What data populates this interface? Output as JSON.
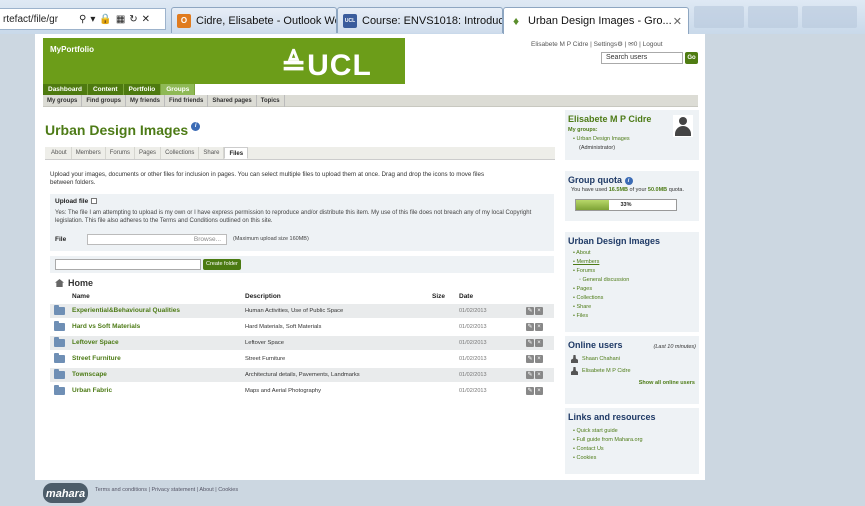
{
  "browser": {
    "address_url": "rtefact/file/gr",
    "tabs": [
      {
        "title": "Cidre, Elisabete - Outlook Web...",
        "icon": "outlook-icon"
      },
      {
        "title": "Course: ENVS1018: Introducing...",
        "icon": "ucl-course-icon"
      },
      {
        "title": "Urban Design Images - Gro...",
        "icon": "mahara-icon"
      }
    ]
  },
  "header": {
    "site_name": "MyPortfolio",
    "logo_text": "≜UCL",
    "user_name": "Elisabete M P Cidre",
    "settings_label": "Settings",
    "inbox_label": "0",
    "logout_label": "Logout",
    "search_placeholder": "Search users",
    "go_label": "Go"
  },
  "main_nav": [
    "Dashboard",
    "Content",
    "Portfolio",
    "Groups"
  ],
  "sub_nav": [
    "My groups",
    "Find groups",
    "My friends",
    "Find friends",
    "Shared pages",
    "Topics"
  ],
  "group": {
    "title": "Urban Design Images",
    "tabs": [
      "About",
      "Members",
      "Forums",
      "Pages",
      "Collections",
      "Share",
      "Files"
    ],
    "active_tab": "Files"
  },
  "files": {
    "intro": "Upload your images, documents or other files for inclusion in pages. You can select multiple files to upload them at once. Drag and drop the icons to move files between folders.",
    "upload_title": "Upload file",
    "declaration": "Yes: The file I am attempting to upload is my own or I have express permission to reproduce and/or distribute this item. My use of this file does not breach any of my local Copyright legislation. This file also adheres to the Terms and Conditions outlined on this site.",
    "file_label": "File",
    "browse_label": "Browse...",
    "max_size": "(Maximum upload size 160MB)",
    "create_folder_label": "Create folder",
    "home_label": "Home",
    "columns": {
      "name": "Name",
      "description": "Description",
      "size": "Size",
      "date": "Date"
    },
    "rows": [
      {
        "name": "Experiential&Behavioural Qualities",
        "description": "Human Activities, Use of Public Space",
        "date": "01/02/2013"
      },
      {
        "name": "Hard vs Soft Materials",
        "description": "Hard Materials, Soft Materials",
        "date": "01/02/2013"
      },
      {
        "name": "Leftover Space",
        "description": "Leftover Space",
        "date": "01/02/2013"
      },
      {
        "name": "Street Furniture",
        "description": "Street Furniture",
        "date": "01/02/2013"
      },
      {
        "name": "Townscape",
        "description": "Architectural details, Pavements, Landmarks",
        "date": "01/02/2013"
      },
      {
        "name": "Urban Fabric",
        "description": "Maps and Aerial Photography",
        "date": "01/02/2013"
      }
    ]
  },
  "sidebar": {
    "profile_name": "Elisabete M P Cidre",
    "my_groups_label": "My groups:",
    "group_link": "Urban Design Images",
    "group_role": "(Administrator)",
    "quota_title": "Group quota",
    "quota_prefix": "You have used",
    "quota_used": "16.5MB",
    "quota_mid": "of your",
    "quota_total": "50.0MB",
    "quota_suffix": "quota.",
    "quota_percent": 33,
    "quota_percent_label": "33%",
    "group_menu_title": "Urban Design Images",
    "group_menu": [
      "About",
      "Members",
      "Forums",
      "General discussion",
      "Pages",
      "Collections",
      "Share",
      "Files"
    ],
    "online_title": "Online users",
    "online_window": "(Last 10 minutes)",
    "online_users": [
      "Shaan Chahani",
      "Elisabete M P Cidre"
    ],
    "show_all_label": "Show all online users",
    "links_title": "Links and resources",
    "links": [
      "Quick start guide",
      "Full guide from Mahara.org",
      "Contact Us",
      "Cookies"
    ]
  },
  "footer": {
    "logo_text": "mahara",
    "links": "Terms and conditions | Privacy statement | About | Cookies"
  }
}
